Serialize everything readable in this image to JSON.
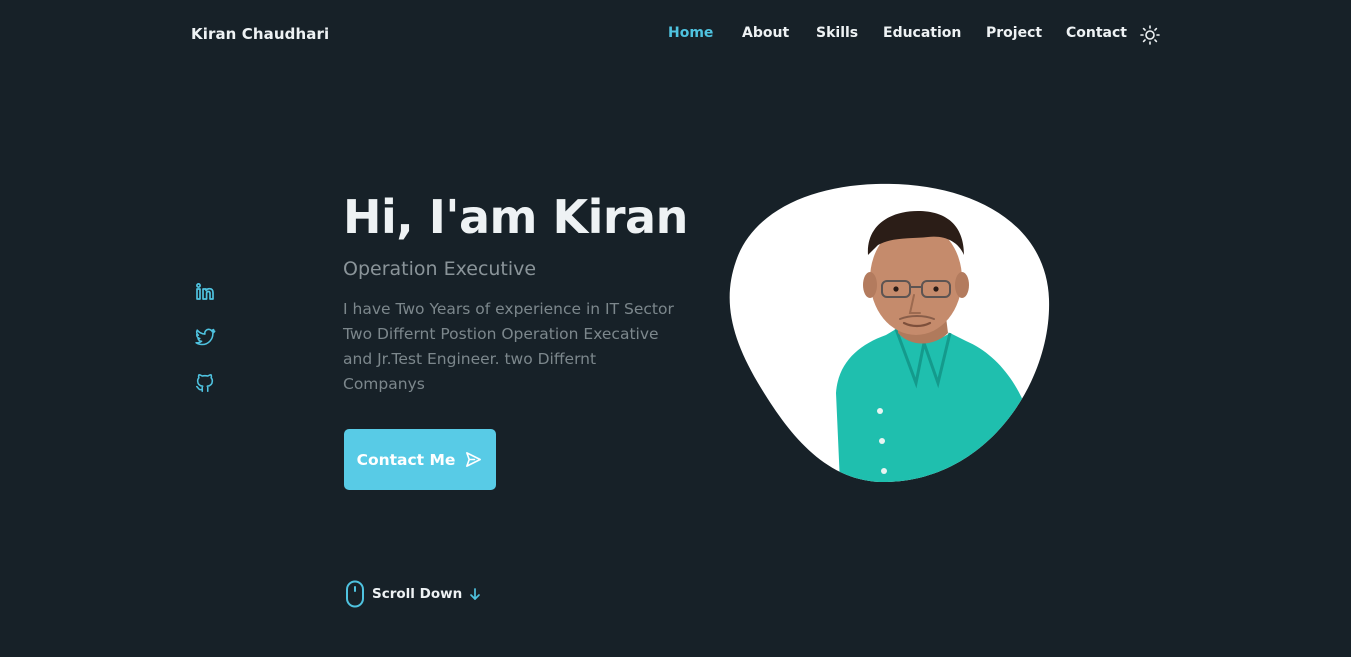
{
  "header": {
    "brand": "Kiran Chaudhari",
    "nav": [
      {
        "label": "Home",
        "active": true
      },
      {
        "label": "About",
        "active": false
      },
      {
        "label": "Skills",
        "active": false
      },
      {
        "label": "Education",
        "active": false
      },
      {
        "label": "Project",
        "active": false
      },
      {
        "label": "Contact",
        "active": false
      }
    ],
    "theme_toggle_icon": "sun-icon"
  },
  "social": [
    {
      "icon": "linkedin-icon"
    },
    {
      "icon": "twitter-icon"
    },
    {
      "icon": "github-icon"
    }
  ],
  "hero": {
    "title": "Hi, I'am Kiran",
    "subtitle": "Operation Executive",
    "description_lines": [
      "I have Two Years of experience in IT Sector",
      "Two Differnt Postion Operation Execative",
      "and Jr.Test Engineer. two Differnt",
      "Companys"
    ],
    "contact_button": "Contact Me",
    "contact_icon": "send-icon"
  },
  "scroll": {
    "label": "Scroll Down",
    "mouse_icon": "mouse-icon",
    "arrow_icon": "arrow-down-icon"
  },
  "avatar": {
    "icon": "profile-photo"
  },
  "colors": {
    "background": "#172128",
    "accent": "#58cbe6",
    "active_nav": "#4fc3e0",
    "text": "#eef2f4",
    "muted": "#7c878c"
  }
}
